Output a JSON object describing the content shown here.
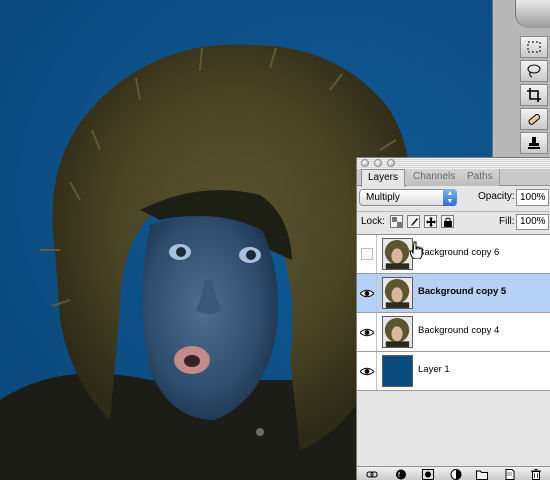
{
  "layers_panel": {
    "tabs": [
      {
        "label": "Layers",
        "active": true
      },
      {
        "label": "Channels",
        "active": false
      },
      {
        "label": "Paths",
        "active": false
      }
    ],
    "blend_mode": "Multiply",
    "opacity_label": "Opacity:",
    "opacity_value": "100%",
    "lock_label": "Lock:",
    "fill_label": "Fill:",
    "fill_value": "100%",
    "layers": [
      {
        "name": "Background copy 6",
        "visible": false,
        "selected": false,
        "thumbnail": "portrait-thumbnail"
      },
      {
        "name": "Background copy 5",
        "visible": true,
        "selected": true,
        "thumbnail": "portrait-thumbnail"
      },
      {
        "name": "Background copy 4",
        "visible": true,
        "selected": false,
        "thumbnail": "portrait-thumbnail"
      },
      {
        "name": "Layer 1",
        "visible": true,
        "selected": false,
        "thumbnail": "solid-blue-thumbnail"
      }
    ]
  },
  "colors": {
    "canvas_background": "#0d4f86",
    "fur": "#4a4424",
    "selection": "#b5d1f5",
    "layer1_fill": "#0b4a7d"
  }
}
